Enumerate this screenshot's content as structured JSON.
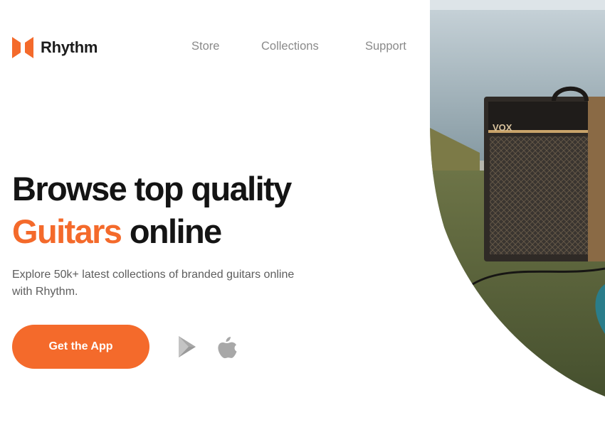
{
  "brand": {
    "name": "Rhythm",
    "accent_color": "#f46a2b",
    "logo_icon": "rhythm-logo-icon"
  },
  "nav": {
    "items": [
      {
        "label": "Store"
      },
      {
        "label": "Collections"
      },
      {
        "label": "Support"
      }
    ]
  },
  "hero": {
    "headline_line1": "Browse top quality",
    "headline_accent": "Guitars",
    "headline_rest": " online",
    "subtext": "Explore 50k+ latest collections of branded guitars online with Rhythm.",
    "cta_label": "Get the App",
    "store_icons": [
      "google-play-icon",
      "apple-icon"
    ],
    "image_subject": "guitar amplifier on grass by the sea"
  },
  "colors": {
    "text_dark": "#141414",
    "text_muted": "#8a8a8a",
    "body_text": "#5d5d5d",
    "icon_gray": "#a8a8a8"
  }
}
